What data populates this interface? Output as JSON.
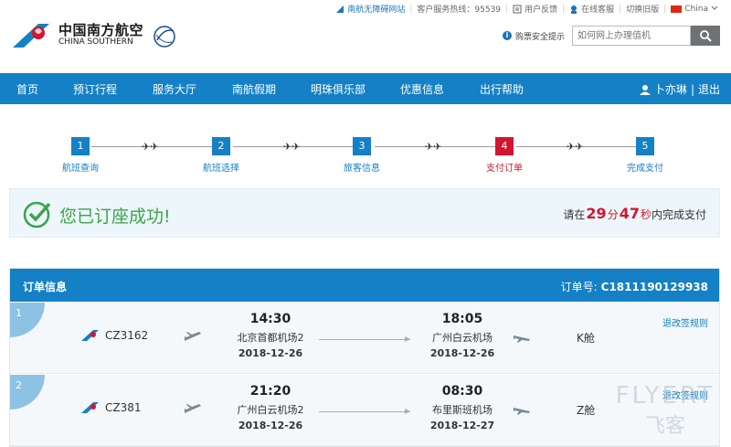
{
  "topbar": {
    "barrier_free": "南航无障碍网站",
    "hotline": "客户服务热线：95539",
    "feedback": "用户反馈",
    "online_service": "在线客服",
    "old_version": "切换旧版",
    "region": "China"
  },
  "logo": {
    "cn": "中国南方航空",
    "en": "CHINA SOUTHERN"
  },
  "header": {
    "safety_tip": "购票安全提示",
    "search_placeholder": "如何网上办理值机"
  },
  "nav": {
    "items": [
      "首页",
      "预订行程",
      "服务大厅",
      "南航假期",
      "明珠俱乐部",
      "优惠信息",
      "出行帮助"
    ],
    "user": "卜亦琳",
    "logout": "退出"
  },
  "steps": [
    {
      "num": "1",
      "label": "航班查询"
    },
    {
      "num": "2",
      "label": "航班选择"
    },
    {
      "num": "3",
      "label": "旅客信息"
    },
    {
      "num": "4",
      "label": "支付订单"
    },
    {
      "num": "5",
      "label": "完成支付"
    }
  ],
  "success": {
    "message": "您已订座成功!",
    "prefix": "请在",
    "minutes": "29",
    "min_unit": "分",
    "seconds": "47",
    "sec_unit": "秒",
    "suffix": "内完成支付"
  },
  "order": {
    "title": "订单信息",
    "number_label": "订单号:",
    "number": "C1811190129938",
    "flights": [
      {
        "index": "1",
        "flight_no": "CZ3162",
        "dep_time": "14:30",
        "dep_airport": "北京首都机场2",
        "dep_date": "2018-12-26",
        "arr_time": "18:05",
        "arr_airport": "广州白云机场",
        "arr_date": "2018-12-26",
        "cabin": "K舱",
        "rule": "退改签规则"
      },
      {
        "index": "2",
        "flight_no": "CZ381",
        "dep_time": "21:20",
        "dep_airport": "广州白云机场2",
        "dep_date": "2018-12-26",
        "arr_time": "08:30",
        "arr_airport": "布里斯班机场",
        "arr_date": "2018-12-27",
        "cabin": "Z舱",
        "rule": "退改签规则"
      }
    ]
  },
  "watermark": {
    "line1": "FLYERT",
    "line2": "飞客"
  },
  "colors": {
    "brand_blue": "#1480c6",
    "active_red": "#d4152f",
    "success_green": "#3aa44a"
  }
}
